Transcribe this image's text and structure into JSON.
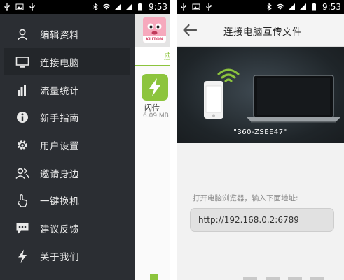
{
  "status_bar": {
    "left_icons": [
      "usb-icon",
      "image-icon",
      "usb-icon"
    ],
    "right_icons": [
      "bluetooth-icon",
      "wifi-icon",
      "signal-icon",
      "signal-icon",
      "battery-icon"
    ],
    "time": "9:53"
  },
  "left_screen": {
    "menu": [
      {
        "label": "编辑资料",
        "icon": "person-icon"
      },
      {
        "label": "连接电脑",
        "icon": "monitor-icon",
        "active": true
      },
      {
        "label": "流量统计",
        "icon": "bar-chart-icon"
      },
      {
        "label": "新手指南",
        "icon": "info-icon"
      },
      {
        "label": "用户设置",
        "icon": "gear-icon"
      },
      {
        "label": "邀请身边",
        "icon": "people-icon"
      },
      {
        "label": "一键换机",
        "icon": "hand-pointer-icon"
      },
      {
        "label": "建议反馈",
        "icon": "chat-bubble-icon"
      },
      {
        "label": "关于我们",
        "icon": "lightning-icon"
      }
    ],
    "avatar_label": "KLITON",
    "tab_partial": "应",
    "app": {
      "name": "闪传",
      "size": "6.09 MB"
    }
  },
  "right_screen": {
    "title": "连接电脑互传文件",
    "device_name": "\"360-ZSEE47\"",
    "hint": "打开电脑浏览器，输入下面地址:",
    "url": "http://192.168.0.2:6789"
  },
  "colors": {
    "drawer_bg": "#2b2e33",
    "accent_green": "#8cc43d",
    "hero_bg": "#1f2529"
  }
}
